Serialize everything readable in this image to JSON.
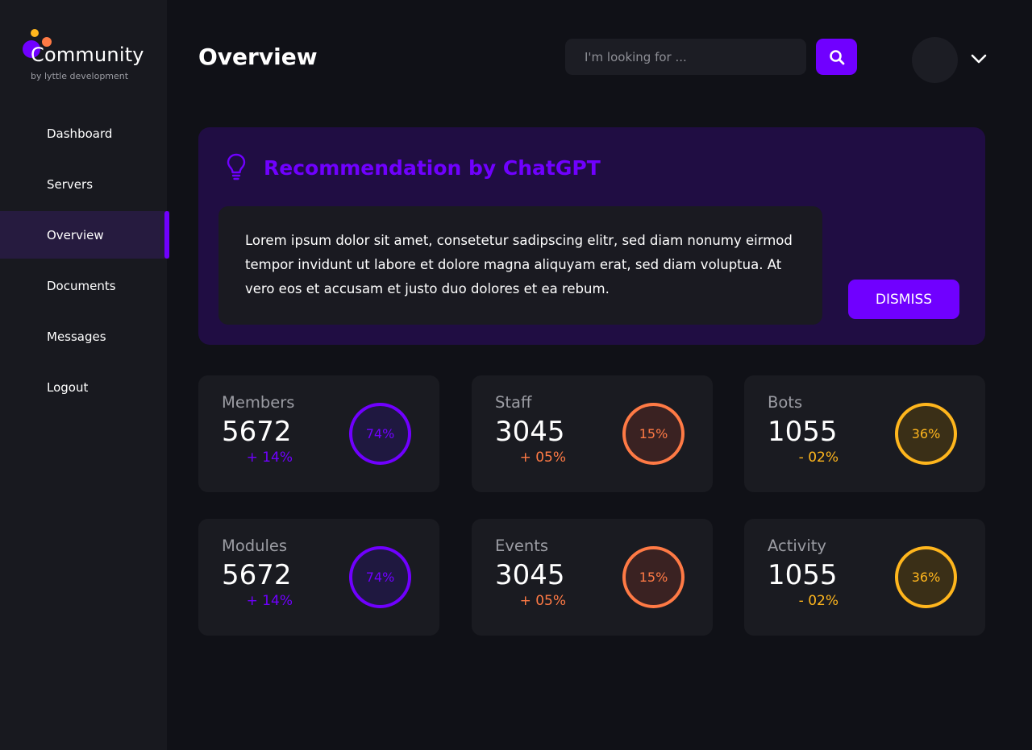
{
  "brand": {
    "name": "Community",
    "tagline": "by lyttle development"
  },
  "sidebar": {
    "items": [
      {
        "label": "Dashboard"
      },
      {
        "label": "Servers"
      },
      {
        "label": "Overview"
      },
      {
        "label": "Documents"
      },
      {
        "label": "Messages"
      },
      {
        "label": "Logout"
      }
    ],
    "active": "Overview"
  },
  "header": {
    "title": "Overview",
    "search_placeholder": "I'm looking for ..."
  },
  "recommendation": {
    "title": "Recommendation by ChatGPT",
    "body": "Lorem ipsum dolor sit amet, consetetur sadipscing elitr, sed diam nonumy eirmod tempor invidunt ut labore et dolore magna aliquyam erat, sed diam voluptua. At vero eos et accusam et justo duo dolores et ea rebum.",
    "dismiss_label": "DISMISS"
  },
  "stats": [
    {
      "label": "Members",
      "value": "5672",
      "change": "+ 14%",
      "percent": "74%",
      "color": "#7000ff"
    },
    {
      "label": "Staff",
      "value": "3045",
      "change": "+ 05%",
      "percent": "15%",
      "color": "#ff7a45"
    },
    {
      "label": "Bots",
      "value": "1055",
      "change": "- 02%",
      "percent": "36%",
      "color": "#ffb61d"
    },
    {
      "label": "Modules",
      "value": "5672",
      "change": "+ 14%",
      "percent": "74%",
      "color": "#7000ff"
    },
    {
      "label": "Events",
      "value": "3045",
      "change": "+ 05%",
      "percent": "15%",
      "color": "#ff7a45"
    },
    {
      "label": "Activity",
      "value": "1055",
      "change": "- 02%",
      "percent": "36%",
      "color": "#ffb61d"
    }
  ],
  "colors": {
    "accent": "#7000ff",
    "orange": "#ff7a45",
    "yellow": "#ffb61d"
  },
  "icons": {
    "search": "search-icon",
    "bulb": "lightbulb-icon",
    "chevron": "chevron-down-icon"
  }
}
